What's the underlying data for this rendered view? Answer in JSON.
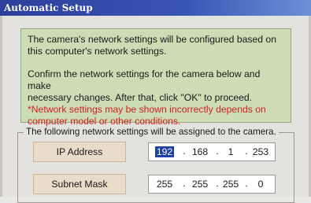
{
  "window": {
    "title": "Automatic Setup"
  },
  "info": {
    "line1": "The camera's network settings will be configured based on",
    "line2": "this computer's network settings.",
    "line3": "Confirm the network settings for the camera below and make",
    "line4": "necessary changes. After that, click \"OK\" to proceed.",
    "warn1": "*Network settings may be shown incorrectly depends on",
    "warn2": "computer model or other conditions."
  },
  "network": {
    "legend": "The following network settings will be assigned to the camera.",
    "ip_label": "IP Address",
    "ip": [
      "192",
      "168",
      "1",
      "253"
    ],
    "subnet_label": "Subnet Mask",
    "subnet": [
      "255",
      "255",
      "255",
      "0"
    ],
    "separator": "."
  },
  "colors": {
    "title_bar": "#2c3f9a",
    "info_bg": "#ccdcb4",
    "warning_text": "#d21f1f",
    "label_bg": "#e9dcc8",
    "selection": "#1f3fa8"
  }
}
